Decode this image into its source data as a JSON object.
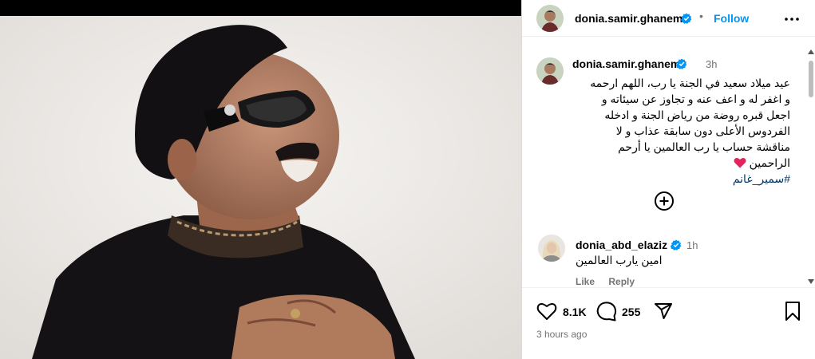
{
  "post": {
    "author": "donia.samir.ghanem",
    "follow_label": "Follow",
    "dot": "•",
    "caption": {
      "author": "donia.samir.ghanem",
      "time": "3h",
      "lines": [
        "عيد ميلاد سعيد في الجنة يا رب، اللهم ارحمه",
        "و اغفر له و اعف عنه و تجاوز عن سيئاته و",
        "اجعل قبره روضة من رياض الجنة و ادخله",
        "الفردوس الأعلى دون سابقة عذاب و لا",
        "مناقشة حساب يا رب العالمين يا أرحم"
      ],
      "last_line_text": "الراحمين",
      "hashtag": "#سمير_غانم"
    },
    "comment": {
      "author": "donia_abd_elaziz",
      "time": "1h",
      "text": "امين يارب العالمين",
      "like_label": "Like",
      "reply_label": "Reply"
    },
    "likes": "8.1K",
    "comments": "255",
    "posted_ago": "3 hours ago"
  },
  "icons": {
    "verified": "verified-badge-icon",
    "more": "more-options-icon",
    "add": "load-more-comments-icon",
    "like": "heart-icon",
    "comment": "comment-icon",
    "share": "share-icon",
    "save": "bookmark-icon"
  },
  "colors": {
    "accent": "#0095f6",
    "verified": "#0095f6",
    "muted": "#737373",
    "hashtag": "#00376b",
    "heart_emoji": "#e0245e"
  }
}
